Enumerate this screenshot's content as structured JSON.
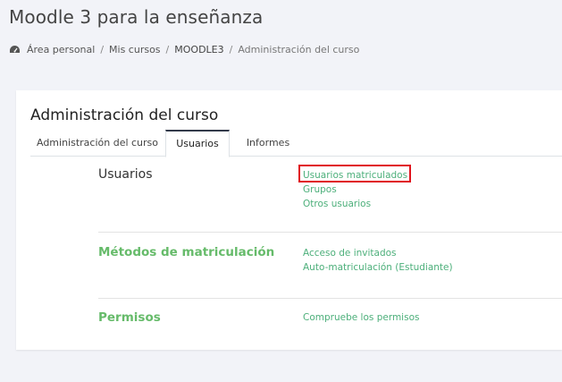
{
  "header": {
    "site_title": "Moodle 3 para la enseñanza"
  },
  "breadcrumb": {
    "items": [
      "Área personal",
      "Mis cursos",
      "MOODLE3",
      "Administración del curso"
    ],
    "separator": "/"
  },
  "card": {
    "title": "Administración del curso",
    "tabs": [
      {
        "label": "Administración del curso",
        "active": false
      },
      {
        "label": "Usuarios",
        "active": true
      },
      {
        "label": "Informes",
        "active": false
      }
    ],
    "sections": [
      {
        "heading": "Usuarios",
        "links": [
          "Usuarios matriculados",
          "Grupos",
          "Otros usuarios"
        ]
      },
      {
        "heading": "Métodos de matriculación",
        "links": [
          "Acceso de invitados",
          "Auto-matriculación (Estudiante)"
        ]
      },
      {
        "heading": "Permisos",
        "links": [
          "Compruebe los permisos"
        ]
      }
    ]
  },
  "colors": {
    "link_green": "#4caf7a",
    "heading_green": "#66bb6a",
    "highlight_red": "#e0141e",
    "background": "#f2f3f8"
  },
  "icons": {
    "home": "dashboard-icon"
  }
}
